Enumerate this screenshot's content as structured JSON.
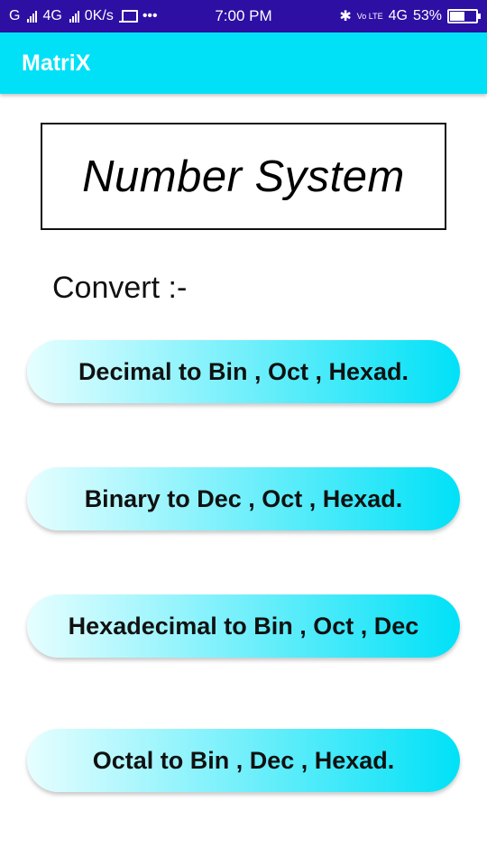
{
  "status_bar": {
    "carrier1": "G",
    "carrier2": "4G",
    "net_speed": "0K/s",
    "more": "•••",
    "time": "7:00 PM",
    "volte": "Vo LTE",
    "network": "4G",
    "battery_pct": "53%",
    "battery_level": 0.53
  },
  "app_bar": {
    "title": "MatriX"
  },
  "main": {
    "title": "Number System",
    "convert_label": "Convert :-",
    "buttons": [
      {
        "label": "Decimal to Bin , Oct , Hexad."
      },
      {
        "label": "Binary to Dec , Oct , Hexad."
      },
      {
        "label": "Hexadecimal to Bin , Oct , Dec"
      },
      {
        "label": "Octal to Bin , Dec , Hexad."
      }
    ]
  },
  "colors": {
    "status_bar": "#2e0fa3",
    "app_bar": "#00e1f7",
    "button_gradient_start": "#e6feff",
    "button_gradient_end": "#00e1f7"
  }
}
